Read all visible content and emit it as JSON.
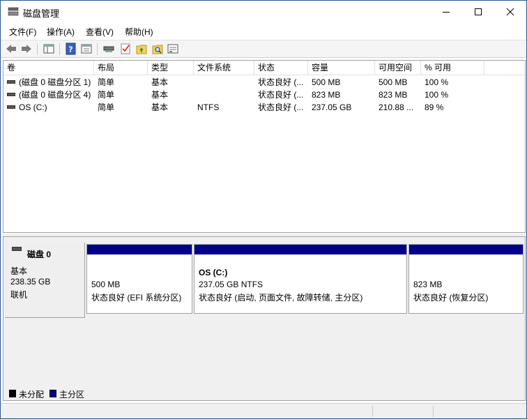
{
  "window": {
    "title": "磁盘管理"
  },
  "menu": [
    {
      "label": "文件(F)"
    },
    {
      "label": "操作(A)"
    },
    {
      "label": "查看(V)"
    },
    {
      "label": "帮助(H)"
    }
  ],
  "toolbar": {
    "buttons": [
      "back-arrow-icon",
      "forward-arrow-icon",
      "console-tree-icon",
      "help-icon",
      "properties-icon",
      "connect-drive-icon",
      "check-icon",
      "folder-up-icon",
      "search-folder-icon",
      "volume-list-icon"
    ]
  },
  "volume_list": {
    "columns": [
      "卷",
      "布局",
      "类型",
      "文件系统",
      "状态",
      "容量",
      "可用空间",
      "% 可用"
    ],
    "rows": [
      {
        "volume": "(磁盘 0 磁盘分区 1)",
        "layout": "简单",
        "type": "基本",
        "fs": "",
        "status": "状态良好 (...",
        "capacity": "500 MB",
        "free": "500 MB",
        "pct": "100 %"
      },
      {
        "volume": "(磁盘 0 磁盘分区 4)",
        "layout": "简单",
        "type": "基本",
        "fs": "",
        "status": "状态良好 (...",
        "capacity": "823 MB",
        "free": "823 MB",
        "pct": "100 %"
      },
      {
        "volume": "OS (C:)",
        "layout": "简单",
        "type": "基本",
        "fs": "NTFS",
        "status": "状态良好 (...",
        "capacity": "237.05 GB",
        "free": "210.88 ...",
        "pct": "89 %"
      }
    ]
  },
  "disk": {
    "name": "磁盘 0",
    "type": "基本",
    "size": "238.35 GB",
    "state": "联机",
    "partitions": [
      {
        "title": "",
        "size": "500 MB",
        "status": "状态良好 (EFI 系统分区)"
      },
      {
        "title": "OS  (C:)",
        "size": "237.05 GB NTFS",
        "status": "状态良好 (启动, 页面文件, 故障转储, 主分区)"
      },
      {
        "title": "",
        "size": "823 MB",
        "status": "状态良好 (恢复分区)"
      }
    ]
  },
  "legend": [
    {
      "label": "未分配",
      "color": "#000000"
    },
    {
      "label": "主分区",
      "color": "#00008b"
    }
  ],
  "colors": {
    "partition_bar": "#00008b",
    "window_border": "#2b5797"
  }
}
